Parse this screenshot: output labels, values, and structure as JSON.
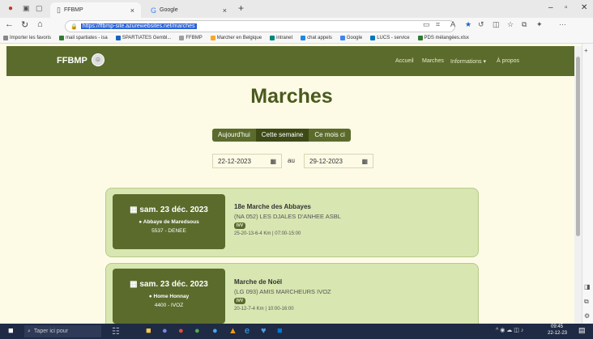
{
  "browser": {
    "tabs": [
      {
        "label": "FFBMP",
        "icon": "page-icon"
      },
      {
        "label": "Google",
        "icon": "google-icon"
      }
    ],
    "new_tab": "+",
    "url": "https://ffbmp-site.azurewebsites.net/marches",
    "favorites": [
      {
        "label": "Importer les favoris",
        "color": "#888888"
      },
      {
        "label": "mail spartiates - isa",
        "color": "#2e7d32"
      },
      {
        "label": "SPARTIATES Gembl...",
        "color": "#1565c0"
      },
      {
        "label": "FFBMP",
        "color": "#9e9e9e"
      },
      {
        "label": "Marcher en Belgique",
        "color": "#f9a825"
      },
      {
        "label": "intranet",
        "color": "#00897b"
      },
      {
        "label": "chat appels",
        "color": "#1e88e5"
      },
      {
        "label": "Google",
        "color": "#4285f4"
      },
      {
        "label": "LUCS - service",
        "color": "#0277bd"
      },
      {
        "label": "PDS mélangées.xlsx",
        "color": "#2e7d32"
      }
    ]
  },
  "site": {
    "brand": "FFBMP",
    "nav": [
      "Accueil",
      "Marches",
      "Informations ▾",
      "À propos"
    ]
  },
  "page": {
    "title": "Marches",
    "filters": [
      "Aujourd'hui",
      "Cette semaine",
      "Ce mois ci"
    ],
    "active_filter": "Cette semaine",
    "date_from": "22-12-2023",
    "date_to": "29-12-2023",
    "date_sep": "au"
  },
  "cards": [
    {
      "date": "sam. 23 déc. 2023",
      "place": "Abbaye de Maredsous",
      "zip": "5537 - DENEE",
      "name": "18e Marche des Abbayes",
      "org": "(NA 052) LES DJALES D'ANHEE ASBL",
      "badge": "IVV",
      "dist": "25-20-13-6-4 Km | 07:00-15:00"
    },
    {
      "date": "sam. 23 déc. 2023",
      "place": "Home Honnay",
      "zip": "4400 - IVOZ",
      "name": "Marche de Noël",
      "org": "(LG 093) AMIS MARCHEURS IVOZ",
      "badge": "IVV",
      "dist": "20-12-7-4 Km | 10:00-16:00"
    }
  ],
  "taskbar": {
    "search_placeholder": "Taper ici pour",
    "clock_time": "09:45",
    "clock_date": "22-12-23"
  }
}
